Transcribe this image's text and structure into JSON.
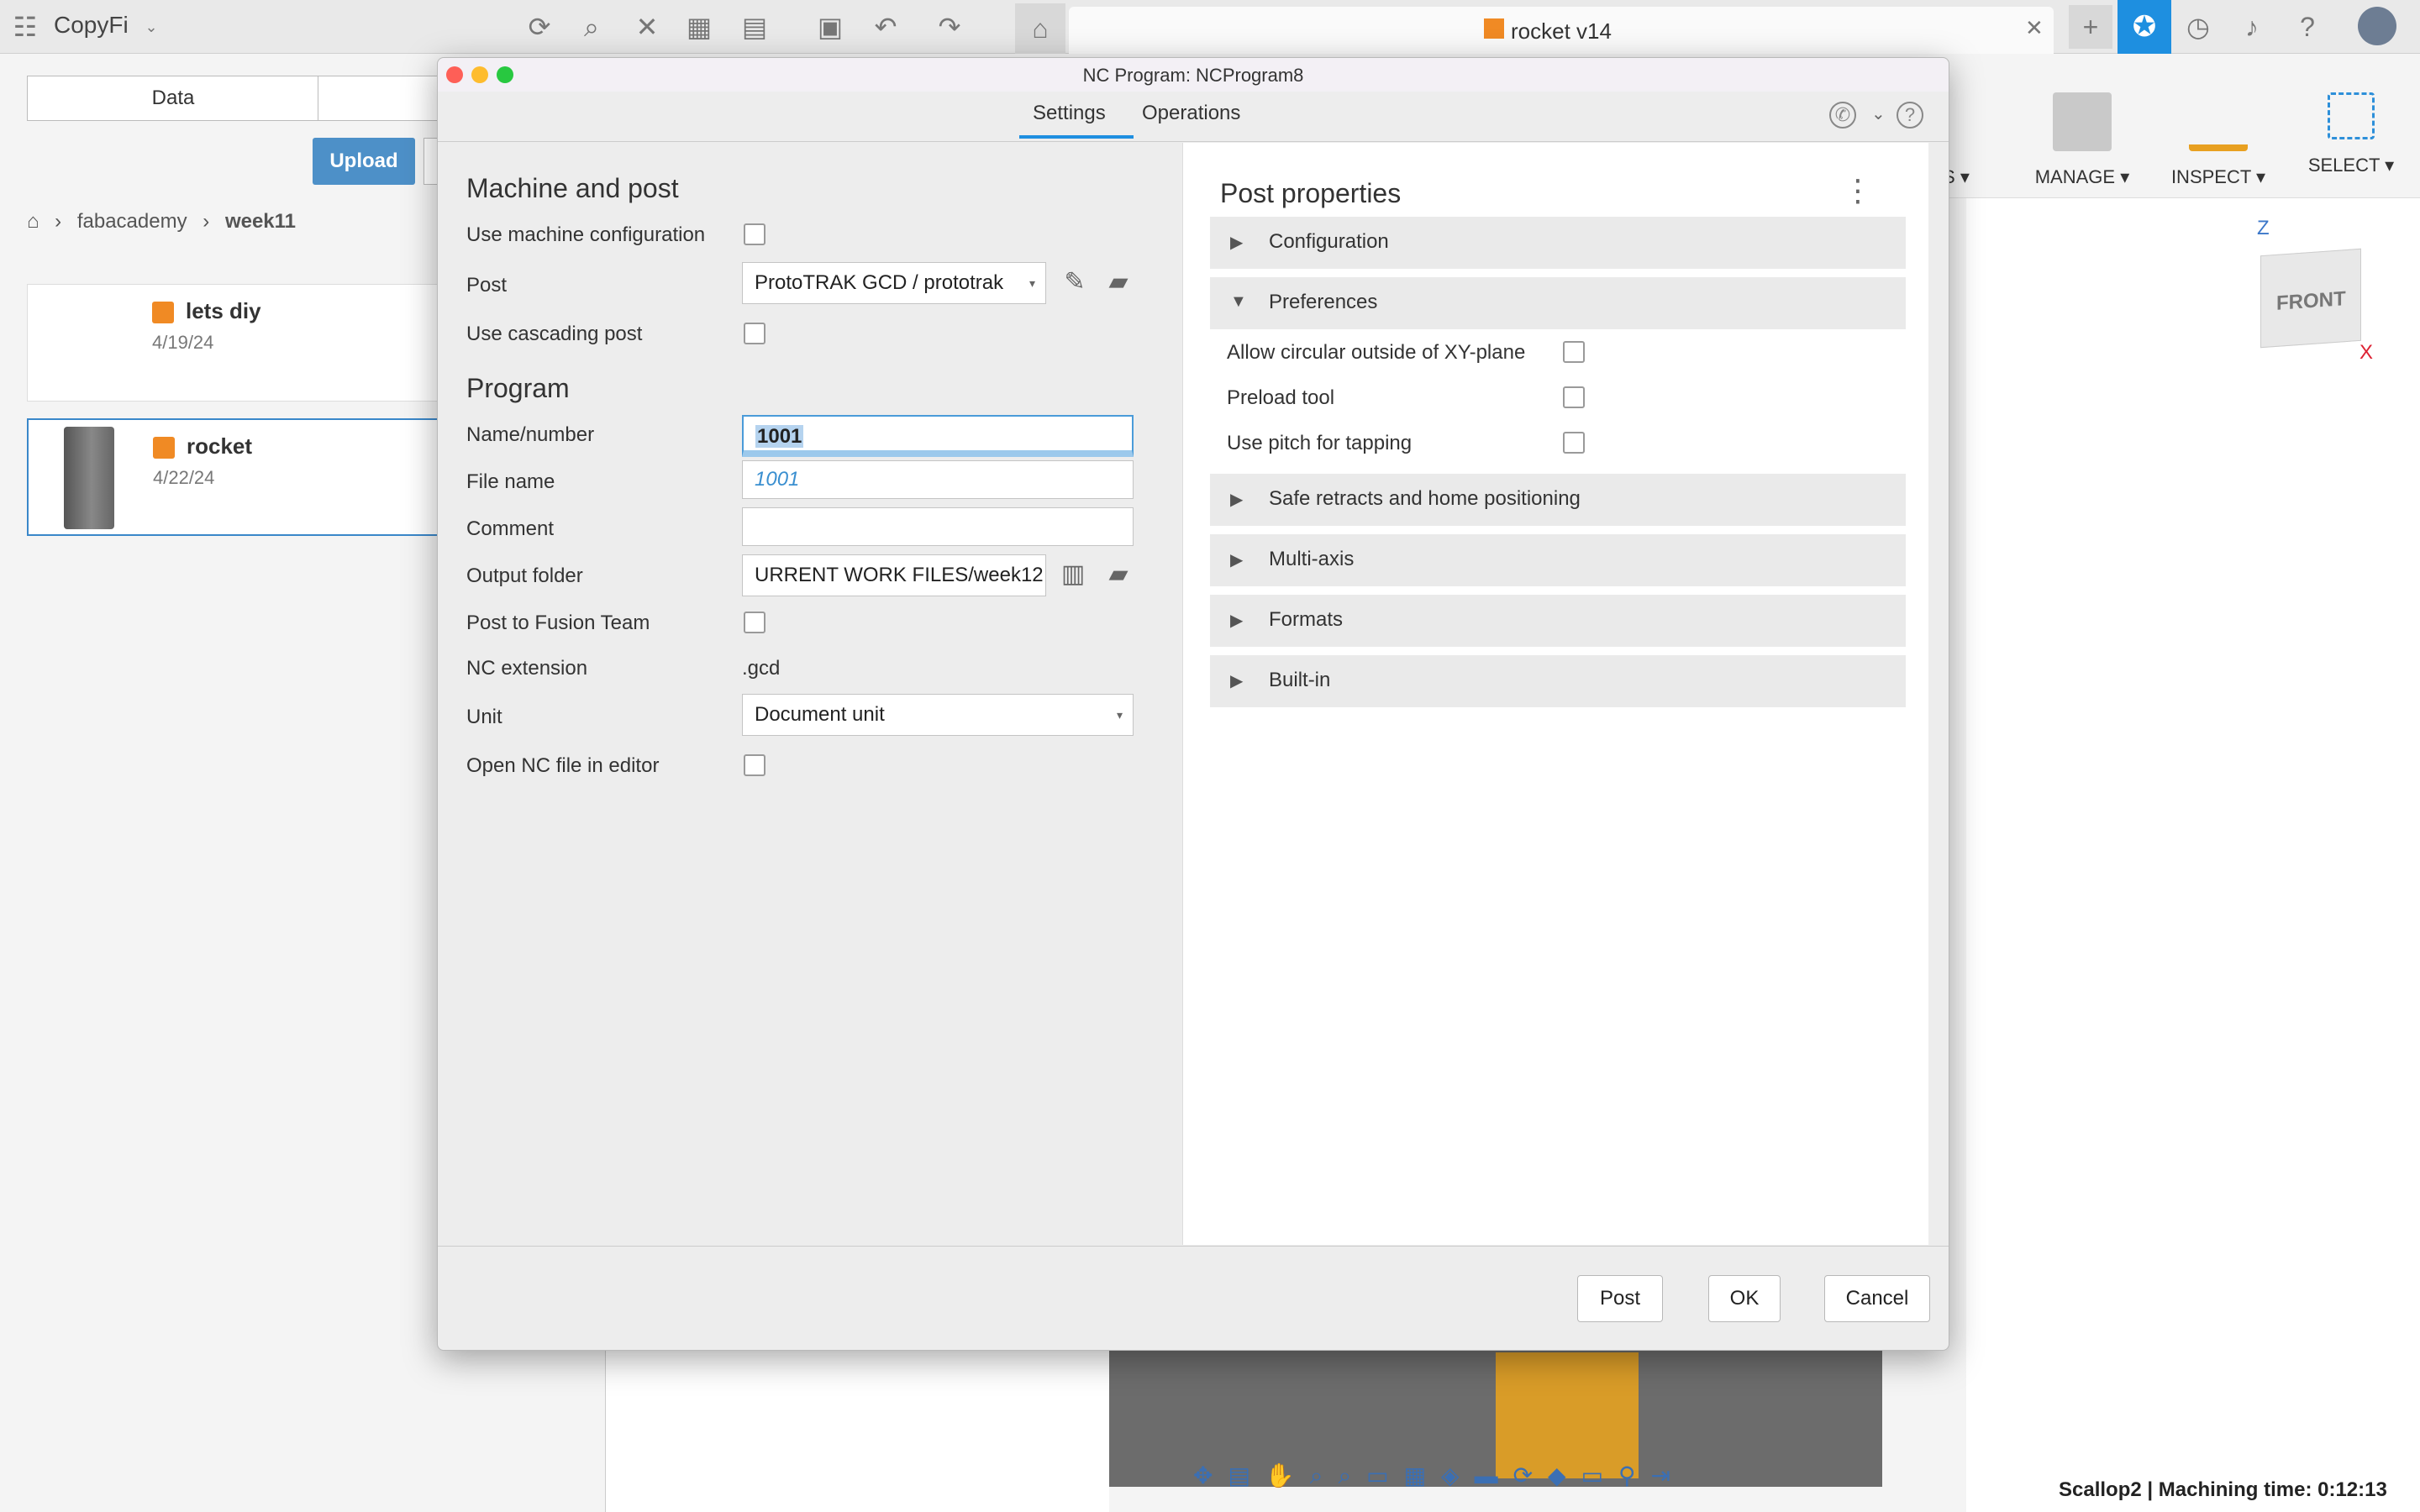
{
  "app": {
    "team_name": "CopyFi",
    "doc_tab_title": "rocket v14",
    "close_tab": "✕",
    "new_tab": "+"
  },
  "data_panel": {
    "tabs": [
      "Data",
      ""
    ],
    "upload_label": "Upload",
    "breadcrumb": [
      "fabacademy",
      "week11"
    ],
    "items": [
      {
        "name": "lets diy",
        "date": "4/19/24"
      },
      {
        "name": "rocket",
        "date": "4/22/24"
      }
    ]
  },
  "toolbar": {
    "partial_label": "NS ▾",
    "manage_label": "MANAGE ▾",
    "inspect_label": "INSPECT ▾",
    "select_label": "SELECT ▾"
  },
  "viewcube": {
    "face": "FRONT",
    "z": "Z",
    "x": "X"
  },
  "status": {
    "text": "Scallop2 | Machining time: 0:12:13"
  },
  "dialog": {
    "title": "NC Program: NCProgram8",
    "tabs": {
      "settings": "Settings",
      "operations": "Operations"
    },
    "machine_section": {
      "title": "Machine and post",
      "use_machine_config_label": "Use machine configuration",
      "post_label": "Post",
      "post_value": "ProtoTRAK GCD / prototrak",
      "use_cascading_label": "Use cascading post"
    },
    "program_section": {
      "title": "Program",
      "name_label": "Name/number",
      "name_value": "1001",
      "file_label": "File name",
      "file_value": "1001",
      "comment_label": "Comment",
      "comment_value": "",
      "output_label": "Output folder",
      "output_value": "URRENT WORK FILES/week12",
      "post_team_label": "Post to Fusion Team",
      "nc_ext_label": "NC extension",
      "nc_ext_value": ".gcd",
      "unit_label": "Unit",
      "unit_value": "Document unit",
      "open_editor_label": "Open NC file in editor"
    },
    "post_properties": {
      "title": "Post properties",
      "groups": {
        "configuration": "Configuration",
        "preferences": "Preferences",
        "safe": "Safe retracts and home positioning",
        "multiaxis": "Multi-axis",
        "formats": "Formats",
        "builtin": "Built-in"
      },
      "prefs": {
        "circular": "Allow circular outside of XY-plane",
        "preload": "Preload tool",
        "pitch": "Use pitch for tapping"
      }
    },
    "buttons": {
      "post": "Post",
      "ok": "OK",
      "cancel": "Cancel"
    }
  },
  "colors": {
    "accent": "#1e8fe0",
    "upload": "#4d90c8",
    "orange": "#f08a24"
  }
}
